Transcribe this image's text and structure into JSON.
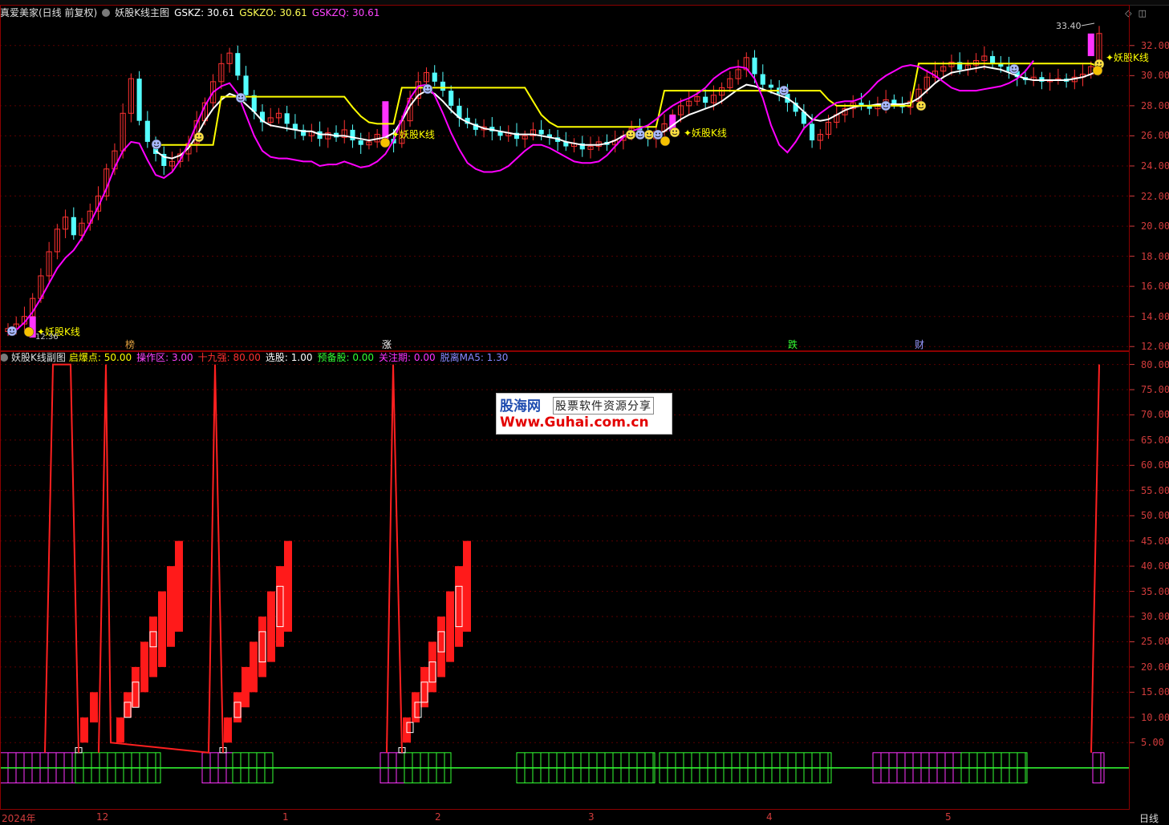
{
  "app": {
    "main_header": {
      "stock": "真爱美家(日线 前复权)",
      "indicator": "妖股K线主图",
      "gskz": "GSKZ: 30.61",
      "gskzo": "GSKZO: 30.61",
      "gskzq": "GSKZQ: 30.61"
    },
    "sub_header": {
      "indicator": "妖股K线副图",
      "items": [
        {
          "text": "启爆点: 50.00",
          "color": "#ffff00"
        },
        {
          "text": "操作区: 3.00",
          "color": "#ff44ff"
        },
        {
          "text": "十九强: 80.00",
          "color": "#ff3030"
        },
        {
          "text": "选股: 1.00",
          "color": "#ffffff"
        },
        {
          "text": "预备股: 0.00",
          "color": "#33ff33"
        },
        {
          "text": "关注期: 0.00",
          "color": "#ff33ff"
        },
        {
          "text": "脱离MA5: 1.30",
          "color": "#8888ff"
        }
      ]
    },
    "markers": {
      "yao_label": "妖股K线",
      "tags": [
        "榜",
        "涨",
        "跌",
        "财"
      ],
      "high_price": "33.40",
      "low_price": "12.36"
    },
    "x_labels": [
      "2024年",
      "12",
      "1",
      "2",
      "3",
      "4",
      "5"
    ],
    "period": "日线",
    "watermark": {
      "brand": "股海网",
      "slogan": "股票软件资源分享",
      "url": "Www.Guhai.com.cn"
    },
    "colors": {
      "up": "#ff3232",
      "down": "#54ffff",
      "ma_white": "#ffffff",
      "ma_yellow": "#ffff00",
      "ma_magenta": "#ff00ff",
      "axis": "#d23c3c"
    }
  },
  "chart_data": [
    {
      "type": "candlestick",
      "panel": "main",
      "yticks": [
        12,
        14,
        16,
        18,
        20,
        22,
        24,
        26,
        28,
        30,
        32
      ],
      "ylim": [
        11.8,
        34.6
      ],
      "tick_labels": [
        "12.00",
        "14.00",
        "16.00",
        "18.00",
        "20.00",
        "22.00",
        "24.00",
        "26.00",
        "28.00",
        "30.00",
        "32.00"
      ],
      "closes": [
        13.2,
        13.5,
        14.0,
        15.2,
        16.7,
        18.3,
        19.8,
        20.6,
        19.4,
        20.2,
        21.0,
        22.0,
        23.8,
        25.0,
        27.5,
        29.8,
        27.0,
        25.6,
        24.8,
        24.0,
        24.3,
        24.8,
        25.5,
        27.0,
        28.2,
        29.6,
        30.8,
        31.5,
        30.0,
        28.7,
        27.6,
        26.9,
        27.2,
        27.5,
        26.8,
        26.4,
        26.0,
        26.3,
        25.8,
        26.2,
        25.9,
        26.4,
        25.7,
        25.4,
        25.6,
        26.1,
        25.8,
        25.5,
        27.0,
        28.5,
        29.6,
        30.2,
        29.6,
        29.0,
        28.0,
        27.2,
        26.8,
        26.4,
        26.6,
        26.3,
        26.0,
        26.2,
        25.8,
        26.0,
        26.4,
        26.1,
        25.9,
        25.6,
        25.3,
        25.5,
        25.1,
        25.3,
        25.6,
        25.4,
        25.7,
        26.0,
        26.5,
        26.2,
        25.8,
        26.3,
        26.8,
        27.4,
        28.0,
        28.3,
        28.6,
        28.2,
        28.7,
        29.2,
        29.8,
        30.4,
        31.2,
        30.1,
        29.4,
        29.2,
        28.8,
        28.2,
        27.6,
        26.8,
        25.7,
        26.1,
        26.9,
        27.4,
        27.8,
        28.2,
        28.0,
        27.8,
        28.1,
        28.4,
        28.1,
        27.9,
        28.3,
        29.1,
        29.9,
        30.3,
        30.6,
        30.9,
        30.4,
        30.7,
        31.0,
        31.3,
        30.8,
        30.6,
        30.3,
        29.9,
        29.7,
        29.9,
        29.6,
        29.7,
        29.8,
        29.6,
        29.9,
        30.1,
        30.6,
        32.8
      ]
    },
    {
      "type": "line",
      "panel": "main",
      "series": [
        {
          "key": "white",
          "values": [
            null,
            null,
            null,
            null,
            null,
            null,
            null,
            null,
            null,
            null,
            null,
            null,
            null,
            null,
            null,
            null,
            null,
            null,
            25.0,
            24.6,
            24.5,
            24.7,
            25.2,
            26.0,
            27.0,
            27.8,
            28.4,
            28.8,
            28.6,
            28.1,
            27.6,
            27.0,
            26.7,
            26.6,
            26.5,
            26.4,
            26.3,
            26.3,
            26.1,
            26.1,
            26.0,
            26.0,
            25.9,
            25.8,
            25.7,
            25.8,
            25.9,
            26.2,
            27.0,
            28.0,
            28.7,
            29.0,
            28.8,
            28.3,
            27.7,
            27.2,
            26.9,
            26.7,
            26.5,
            26.4,
            26.3,
            26.2,
            26.1,
            26.1,
            26.1,
            26.0,
            25.9,
            25.8,
            25.6,
            25.5,
            25.4,
            25.4,
            25.4,
            25.5,
            25.7,
            26.0,
            26.2,
            26.1,
            26.0,
            26.1,
            26.3,
            26.7,
            27.1,
            27.4,
            27.6,
            27.8,
            28.0,
            28.3,
            28.7,
            29.1,
            29.4,
            29.3,
            29.1,
            28.9,
            28.7,
            28.5,
            28.1,
            27.6,
            27.1,
            27.0,
            27.1,
            27.4,
            27.7,
            27.9,
            28.0,
            28.0,
            28.1,
            28.1,
            28.1,
            28.1,
            28.2,
            28.5,
            29.0,
            29.5,
            29.9,
            30.2,
            30.3,
            30.4,
            30.5,
            30.6,
            30.5,
            30.4,
            30.2,
            30.0,
            29.8,
            29.7,
            29.7,
            29.7,
            29.7,
            29.7,
            29.8,
            29.9,
            30.1,
            30.4
          ]
        },
        {
          "key": "yellow",
          "values": [
            null,
            null,
            null,
            null,
            null,
            null,
            null,
            null,
            null,
            null,
            null,
            null,
            null,
            null,
            null,
            null,
            null,
            null,
            25.4,
            25.4,
            25.4,
            25.4,
            25.4,
            25.4,
            25.4,
            25.4,
            28.6,
            28.6,
            28.6,
            28.6,
            28.6,
            28.6,
            28.6,
            28.6,
            28.6,
            28.6,
            28.6,
            28.6,
            28.6,
            28.6,
            28.6,
            28.6,
            27.9,
            27.3,
            26.9,
            26.8,
            26.8,
            26.8,
            29.2,
            29.2,
            29.2,
            29.2,
            29.2,
            29.2,
            29.2,
            29.2,
            29.2,
            29.2,
            29.2,
            29.2,
            29.2,
            29.2,
            29.2,
            29.2,
            28.3,
            27.4,
            26.9,
            26.6,
            26.6,
            26.6,
            26.6,
            26.6,
            26.6,
            26.6,
            26.6,
            26.6,
            26.6,
            26.6,
            26.6,
            26.6,
            29.0,
            29.0,
            29.0,
            29.0,
            29.0,
            29.0,
            29.0,
            29.0,
            29.0,
            29.0,
            29.0,
            29.0,
            29.0,
            29.0,
            29.0,
            29.0,
            29.0,
            29.0,
            29.0,
            29.0,
            28.4,
            28.0,
            28.0,
            28.0,
            28.0,
            28.0,
            28.0,
            28.0,
            28.0,
            28.0,
            28.0,
            30.8,
            30.8,
            30.8,
            30.8,
            30.8,
            30.8,
            30.8,
            30.8,
            30.8,
            30.8,
            30.8,
            30.8,
            30.8,
            30.8,
            30.8,
            30.8,
            30.8,
            30.8,
            30.8,
            30.8,
            30.8,
            30.8,
            30.6
          ]
        },
        {
          "key": "magenta",
          "values": [
            12.8,
            13.1,
            13.6,
            14.3,
            15.2,
            16.2,
            17.2,
            17.9,
            18.4,
            19.2,
            20.2,
            21.3,
            22.5,
            23.9,
            25.0,
            25.6,
            25.5,
            24.4,
            23.4,
            23.2,
            23.6,
            24.4,
            25.5,
            26.8,
            28.0,
            28.9,
            29.3,
            29.5,
            28.8,
            27.4,
            26.0,
            25.0,
            24.6,
            24.5,
            24.5,
            24.4,
            24.3,
            24.3,
            24.0,
            24.1,
            24.1,
            24.3,
            24.1,
            23.9,
            24.0,
            24.3,
            24.8,
            25.7,
            27.1,
            28.5,
            29.3,
            29.4,
            28.7,
            27.5,
            26.2,
            25.1,
            24.2,
            23.8,
            23.6,
            23.6,
            23.7,
            24.0,
            24.5,
            25.0,
            25.4,
            25.4,
            25.2,
            24.9,
            24.6,
            24.3,
            24.2,
            24.2,
            24.3,
            24.7,
            25.3,
            25.9,
            26.3,
            26.5,
            26.7,
            27.1,
            27.6,
            28.0,
            28.3,
            28.5,
            28.8,
            29.2,
            29.8,
            30.2,
            30.5,
            30.6,
            30.5,
            29.8,
            28.5,
            26.7,
            25.4,
            24.9,
            25.6,
            26.5,
            27.0,
            27.5,
            27.9,
            28.2,
            28.3,
            28.3,
            28.5,
            29.0,
            29.6,
            30.0,
            30.3,
            30.6,
            30.7,
            30.6,
            30.3,
            30.0,
            29.6,
            29.2,
            29.0,
            29.0,
            29.0,
            29.1,
            29.2,
            29.3,
            29.5,
            29.8,
            30.3,
            31.0
          ]
        }
      ]
    },
    {
      "type": "bar",
      "panel": "sub",
      "yticks": [
        5,
        10,
        15,
        20,
        25,
        30,
        35,
        40,
        45,
        50,
        55,
        60,
        65,
        70,
        75,
        80
      ],
      "ylim": [
        -8,
        82
      ],
      "tick_labels": [
        "5.00",
        "10.00",
        "15.00",
        "20.00",
        "25.00",
        "30.00",
        "35.00",
        "40.00",
        "45.00",
        "50.00",
        "55.00",
        "60.00",
        "65.00",
        "70.00",
        "75.00",
        "80.00"
      ],
      "red_boxes": [
        [
          105,
          5,
          10
        ],
        [
          117,
          9,
          15
        ],
        [
          150,
          5,
          10
        ],
        [
          159,
          10,
          15
        ],
        [
          169,
          12,
          20
        ],
        [
          180,
          15,
          25
        ],
        [
          191,
          18,
          30
        ],
        [
          202,
          20,
          35
        ],
        [
          213,
          24,
          40
        ],
        [
          223,
          27,
          45
        ],
        [
          284,
          5,
          10
        ],
        [
          296,
          9,
          15
        ],
        [
          306,
          12,
          20
        ],
        [
          316,
          15,
          25
        ],
        [
          327,
          18,
          30
        ],
        [
          338,
          21,
          35
        ],
        [
          349,
          24,
          40
        ],
        [
          359,
          27,
          45
        ],
        [
          507,
          5,
          10
        ],
        [
          518,
          9,
          15
        ],
        [
          529,
          12,
          20
        ],
        [
          539,
          15,
          25
        ],
        [
          550,
          18,
          30
        ],
        [
          561,
          21,
          35
        ],
        [
          572,
          24,
          40
        ],
        [
          582,
          27,
          45
        ]
      ],
      "white_boxes": [
        [
          98,
          3,
          4
        ],
        [
          159,
          10,
          13
        ],
        [
          169,
          12,
          17
        ],
        [
          191,
          24,
          27
        ],
        [
          278,
          3,
          4
        ],
        [
          296,
          10,
          13
        ],
        [
          327,
          21,
          27
        ],
        [
          349,
          28,
          36
        ],
        [
          501,
          3,
          4
        ],
        [
          511,
          7,
          9
        ],
        [
          521,
          10,
          13
        ],
        [
          529,
          13,
          17
        ],
        [
          539,
          17,
          21
        ],
        [
          550,
          23,
          27
        ],
        [
          572,
          28,
          36
        ]
      ],
      "zigzag": [
        [
          56,
          3
        ],
        [
          66,
          80
        ],
        [
          88,
          80
        ],
        [
          98,
          3
        ],
        [
          123,
          3
        ],
        [
          132,
          80
        ],
        [
          138,
          5
        ],
        [
          260,
          3
        ],
        [
          268,
          80
        ],
        [
          278,
          3
        ],
        [
          482,
          3
        ],
        [
          490,
          80
        ],
        [
          501,
          3
        ],
        [
          1360,
          3
        ],
        [
          1370,
          80
        ]
      ],
      "magenta_bands": [
        [
          0,
          94
        ],
        [
          252,
          290
        ],
        [
          474,
          504
        ],
        [
          1088,
          1198
        ],
        [
          1362,
          1376
        ]
      ],
      "green_bands": [
        [
          94,
          200
        ],
        [
          290,
          340
        ],
        [
          504,
          562
        ],
        [
          644,
          816
        ],
        [
          822,
          1036
        ],
        [
          1198,
          1280
        ]
      ]
    }
  ]
}
